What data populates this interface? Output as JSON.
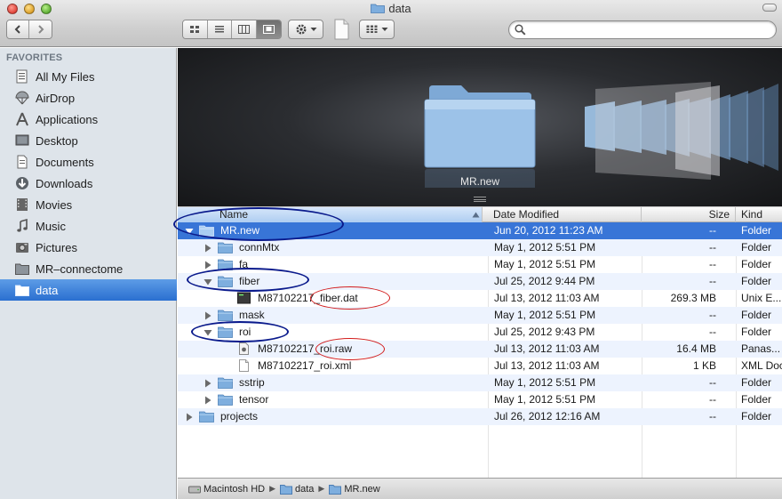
{
  "window": {
    "title": "data"
  },
  "toolbar": {
    "back_icon": "chevron-left-icon",
    "forward_icon": "chevron-right-icon",
    "view_modes": [
      "icon-view",
      "list-view",
      "column-view",
      "cover-flow-view"
    ],
    "active_view": "cover-flow-view",
    "action_icon": "gear-icon",
    "arrange_icon": "arrange-grid-icon"
  },
  "search": {
    "value": "",
    "placeholder": ""
  },
  "sidebar": {
    "heading": "FAVORITES",
    "items": [
      {
        "label": "All My Files",
        "icon": "all-files-icon"
      },
      {
        "label": "AirDrop",
        "icon": "airdrop-icon"
      },
      {
        "label": "Applications",
        "icon": "applications-icon"
      },
      {
        "label": "Desktop",
        "icon": "desktop-icon"
      },
      {
        "label": "Documents",
        "icon": "documents-icon"
      },
      {
        "label": "Downloads",
        "icon": "downloads-icon"
      },
      {
        "label": "Movies",
        "icon": "movies-icon"
      },
      {
        "label": "Music",
        "icon": "music-icon"
      },
      {
        "label": "Pictures",
        "icon": "pictures-icon"
      },
      {
        "label": "MR–connectome",
        "icon": "folder-icon"
      },
      {
        "label": "data",
        "icon": "folder-icon"
      }
    ],
    "selected": "data"
  },
  "coverflow": {
    "label": "MR.new"
  },
  "columns": {
    "name": "Name",
    "date": "Date Modified",
    "size": "Size",
    "kind": "Kind"
  },
  "files": [
    {
      "name": "MR.new",
      "date": "Jun 20, 2012 11:23 AM",
      "size": "--",
      "kind": "Folder",
      "depth": 0,
      "type": "folder",
      "expanded": true,
      "selected": true
    },
    {
      "name": "connMtx",
      "date": "May 1, 2012 5:51 PM",
      "size": "--",
      "kind": "Folder",
      "depth": 1,
      "type": "folder",
      "expanded": false
    },
    {
      "name": "fa",
      "date": "May 1, 2012 5:51 PM",
      "size": "--",
      "kind": "Folder",
      "depth": 1,
      "type": "folder",
      "expanded": false
    },
    {
      "name": "fiber",
      "date": "Jul 25, 2012 9:44 PM",
      "size": "--",
      "kind": "Folder",
      "depth": 1,
      "type": "folder",
      "expanded": true
    },
    {
      "name": "M87102217_fiber.dat",
      "date": "Jul 13, 2012 11:03 AM",
      "size": "269.3 MB",
      "kind": "Unix E...",
      "depth": 2,
      "type": "exec"
    },
    {
      "name": "mask",
      "date": "May 1, 2012 5:51 PM",
      "size": "--",
      "kind": "Folder",
      "depth": 1,
      "type": "folder",
      "expanded": false
    },
    {
      "name": "roi",
      "date": "Jul 25, 2012 9:43 PM",
      "size": "--",
      "kind": "Folder",
      "depth": 1,
      "type": "folder",
      "expanded": true
    },
    {
      "name": "M87102217_roi.raw",
      "date": "Jul 13, 2012 11:03 AM",
      "size": "16.4 MB",
      "kind": "Panas...",
      "depth": 2,
      "type": "raw"
    },
    {
      "name": "M87102217_roi.xml",
      "date": "Jul 13, 2012 11:03 AM",
      "size": "1 KB",
      "kind": "XML Doc",
      "depth": 2,
      "type": "doc"
    },
    {
      "name": "sstrip",
      "date": "May 1, 2012 5:51 PM",
      "size": "--",
      "kind": "Folder",
      "depth": 1,
      "type": "folder",
      "expanded": false
    },
    {
      "name": "tensor",
      "date": "May 1, 2012 5:51 PM",
      "size": "--",
      "kind": "Folder",
      "depth": 1,
      "type": "folder",
      "expanded": false
    },
    {
      "name": "projects",
      "date": "Jul 26, 2012 12:16 AM",
      "size": "--",
      "kind": "Folder",
      "depth": 0,
      "type": "folder",
      "expanded": false
    }
  ],
  "pathbar": {
    "crumbs": [
      {
        "label": "Macintosh HD",
        "icon": "hard-drive-icon"
      },
      {
        "label": "data",
        "icon": "folder-icon"
      },
      {
        "label": "MR.new",
        "icon": "folder-icon"
      }
    ]
  },
  "colors": {
    "selection_blue": "#3875d7",
    "sidebar_bg": "#dee4ea",
    "folder_blue": "#7eaede",
    "annotation_blue": "#0a1a8c",
    "annotation_red": "#d21a1a"
  }
}
